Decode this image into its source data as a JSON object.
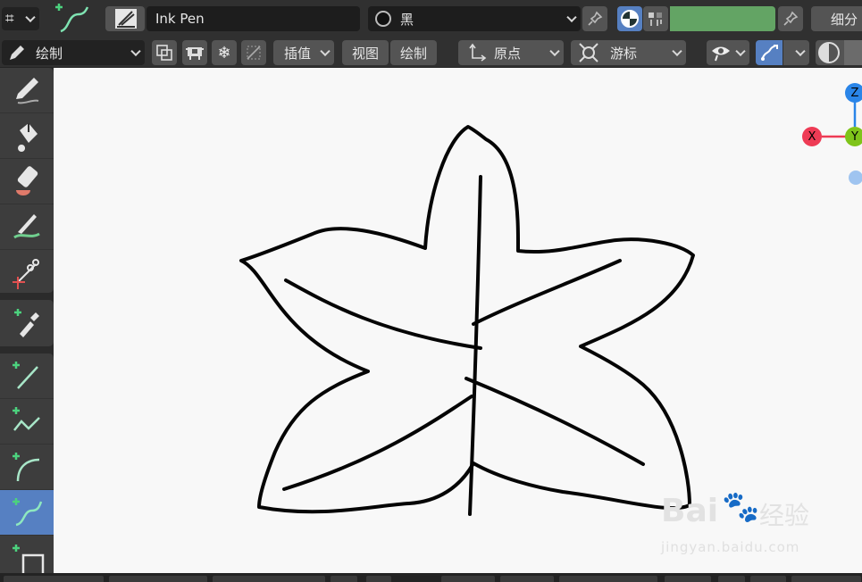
{
  "header": {
    "brush_name": "Ink Pen",
    "material_name": "黑",
    "color_hex": "#63a464",
    "subdivide_label": "细分"
  },
  "tool_header": {
    "mode_label": "绘制",
    "interpolate_label": "插值",
    "view_label": "视图",
    "draw_label": "绘制",
    "origin_label": "原点",
    "cursor_label": "游标"
  },
  "gizmo": {
    "z_label": "Z",
    "x_label": "X",
    "y_label": "Y",
    "colors": {
      "x": "#ee3b55",
      "y": "#7fc41a",
      "z": "#2a85e8",
      "neg": "#9fc4f0"
    }
  },
  "toolbar": {
    "tools": [
      "draw-pen",
      "fill",
      "erase",
      "tint",
      "cutter",
      "eyedropper",
      "line",
      "polyline",
      "arc",
      "curve",
      "box"
    ],
    "active": "curve"
  },
  "watermark": {
    "logo_text": "Bai",
    "logo_text2": "经验",
    "site": "jingyan.baidu.com"
  }
}
